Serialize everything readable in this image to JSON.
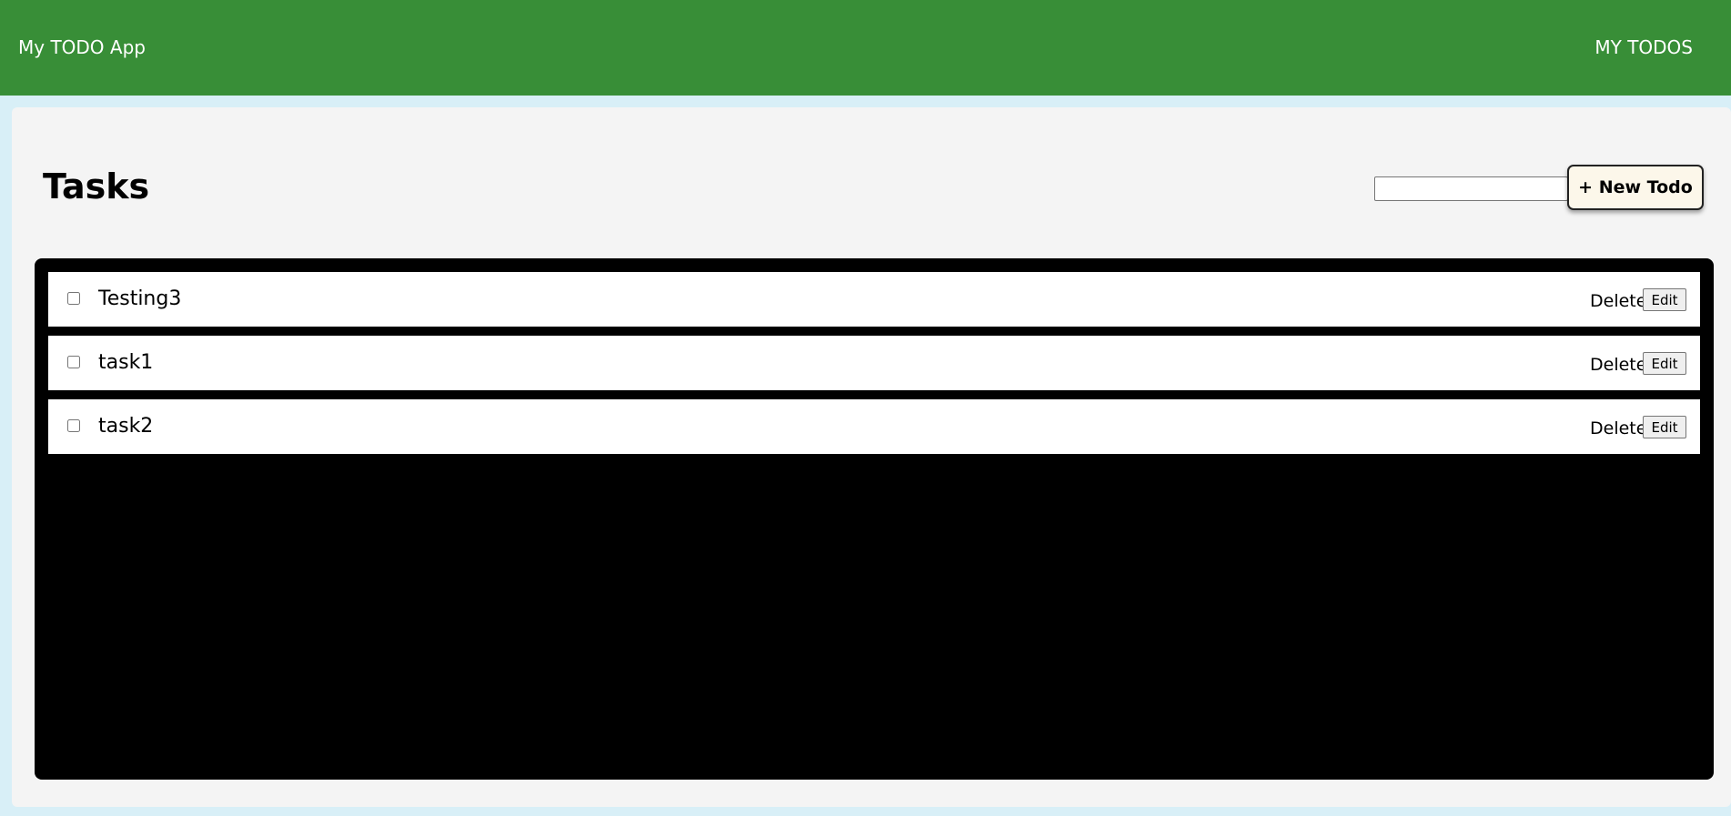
{
  "navbar": {
    "brand": "My TODO App",
    "link": "MY TODOS",
    "color": "#388e37"
  },
  "main": {
    "title": "Tasks",
    "new_todo": {
      "input_value": "",
      "button_label": "+ New Todo"
    },
    "tasks": [
      {
        "title": "Testing3",
        "checked": false,
        "delete_label": "Delete",
        "edit_label": "Edit"
      },
      {
        "title": "task1",
        "checked": false,
        "delete_label": "Delete",
        "edit_label": "Edit"
      },
      {
        "title": "task2",
        "checked": false,
        "delete_label": "Delete",
        "edit_label": "Edit"
      }
    ]
  }
}
